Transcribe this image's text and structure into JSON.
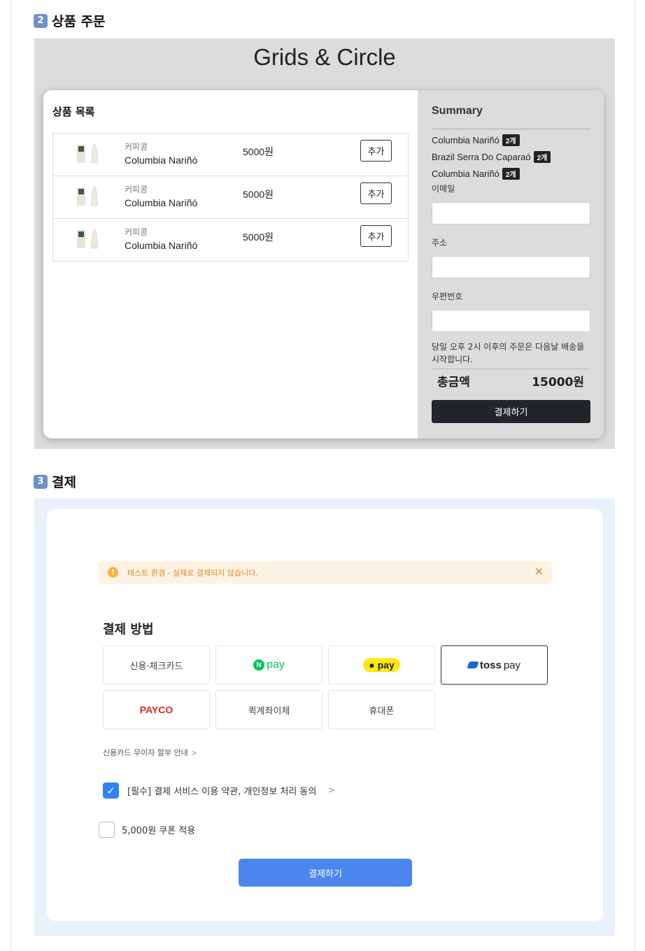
{
  "section2": {
    "badge": "2",
    "heading": "상품 주문",
    "banner_title": "Grids & Circle",
    "products_title": "상품 목록",
    "products": [
      {
        "category": "커피콩",
        "name": "Columbia Nariñó",
        "price": "5000원",
        "add_label": "추가"
      },
      {
        "category": "커피콩",
        "name": "Columbia Nariñó",
        "price": "5000원",
        "add_label": "추가"
      },
      {
        "category": "커피콩",
        "name": "Columbia Nariñó",
        "price": "5000원",
        "add_label": "추가"
      }
    ],
    "summary": {
      "title": "Summary",
      "items": [
        {
          "name": "Columbia Nariñó",
          "qty": "2개"
        },
        {
          "name": "Brazil Serra Do Caparaó",
          "qty": "2개"
        },
        {
          "name": "Columbia Nariñó",
          "qty": "2개"
        }
      ],
      "email_label": "이메일",
      "email_value": "",
      "address_label": "주소",
      "address_value": "",
      "zip_label": "우편번호",
      "zip_value": "",
      "notice": "당일 오후 2시 이후의 주문은 다음날 배송을 시작합니다.",
      "total_label": "총금액",
      "total_value": "15000원",
      "checkout_label": "결제하기"
    }
  },
  "section3": {
    "badge": "3",
    "heading": "결제",
    "alert_icon": "!",
    "alert_text": "테스트 환경 - 실제로 결제되지 않습니다.",
    "alert_close": "✕",
    "method_title": "결제 방법",
    "methods": {
      "card": "신용·체크카드",
      "npay_letter": "N",
      "npay": "pay",
      "kpay": "pay",
      "tosspay_bold": "toss",
      "tosspay": "pay",
      "payco": "PAYCO",
      "transfer": "퀵계좌이체",
      "phone": "휴대폰"
    },
    "installment_text": "신용카드 무이자 할부 안내",
    "chevron": ">",
    "agree_text": "[필수] 결제 서비스 이용 약관, 개인정보 처리 동의",
    "agree_checked": true,
    "coupon_text": "5,000원 쿠폰 적용",
    "coupon_checked": false,
    "pay_label": "결제하기"
  }
}
